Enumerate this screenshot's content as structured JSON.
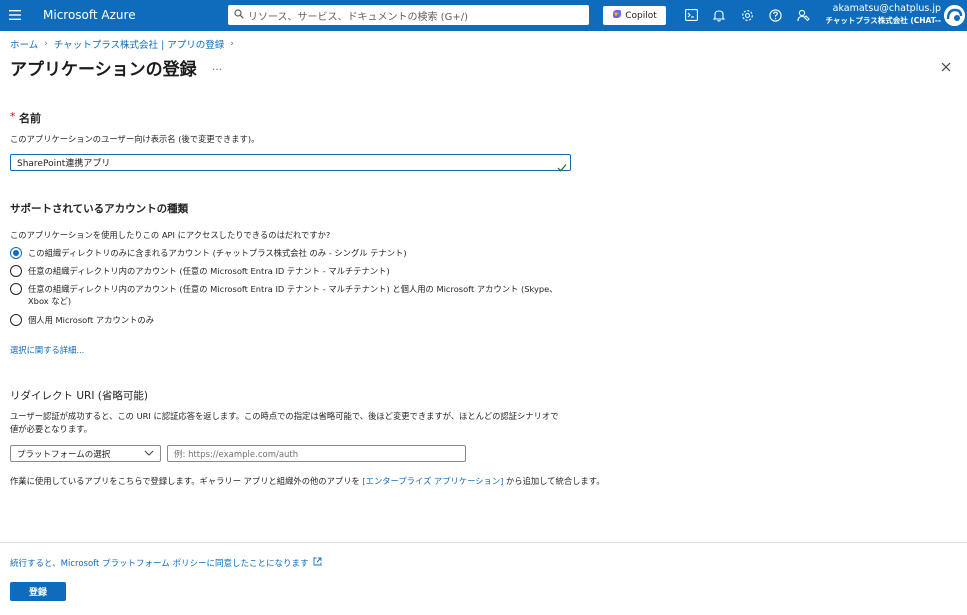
{
  "topbar": {
    "brand": "Microsoft Azure",
    "search_placeholder": "リソース、サービス、ドキュメントの検索 (G+/)",
    "copilot_label": "Copilot",
    "account_email": "akamatsu@chatplus.jp",
    "account_org": "チャットプラス株式会社 (CHAT--",
    "icons": [
      "hamburger-icon",
      "search-icon",
      "cloud-shell-icon",
      "notifications-icon",
      "settings-icon",
      "help-icon",
      "feedback-icon"
    ]
  },
  "breadcrumb": {
    "home": "ホーム",
    "org": "チャットプラス株式会社 | アプリの登録"
  },
  "page": {
    "title": "アプリケーションの登録",
    "more": "…"
  },
  "name_section": {
    "required_mark": "*",
    "label": "名前",
    "help": "このアプリケーションのユーザー向け表示名 (後で変更できます)。",
    "value": "SharePoint連携アプリ"
  },
  "account_types": {
    "heading": "サポートされているアカウントの種類",
    "question": "このアプリケーションを使用したりこの API にアクセスしたりできるのはだれですか?",
    "options": [
      {
        "label": "この組織ディレクトリのみに含まれるアカウント (チャットプラス株式会社 のみ - シングル テナント)",
        "selected": true
      },
      {
        "label": "任意の組織ディレクトリ内のアカウント (任意の Microsoft Entra ID テナント - マルチテナント)",
        "selected": false
      },
      {
        "label_line1": "任意の組織ディレクトリ内のアカウント (任意の Microsoft Entra ID テナント - マルチテナント) と個人用の Microsoft アカウント (Skype、",
        "label_line2": "Xbox など)",
        "selected": false
      },
      {
        "label": "個人用 Microsoft アカウントのみ",
        "selected": false
      }
    ],
    "more_link": "選択に関する詳細..."
  },
  "redirect": {
    "heading": "リダイレクト URI (省略可能)",
    "help_line1": "ユーザー認証が成功すると、この URI に認証応答を返します。この時点での指定は省略可能で、後ほど変更できますが、ほとんどの認証シナリオで",
    "help_line2": "値が必要となります。",
    "platform_selected": "プラットフォームの選択",
    "uri_placeholder": "例: https://example.com/auth"
  },
  "gallery_note": {
    "before": "作業に使用しているアプリをこちらで登録します。ギャラリー アプリと組織外の他のアプリを ",
    "link": "[エンタープライズ アプリケーション]",
    "after": " から追加して統合します。"
  },
  "footer": {
    "policy": "続行すると、Microsoft プラットフォーム ポリシーに同意したことになります",
    "register": "登録"
  },
  "colors": {
    "accent": "#0f6cbd",
    "required": "#c50f1f",
    "check": "#107c10"
  }
}
